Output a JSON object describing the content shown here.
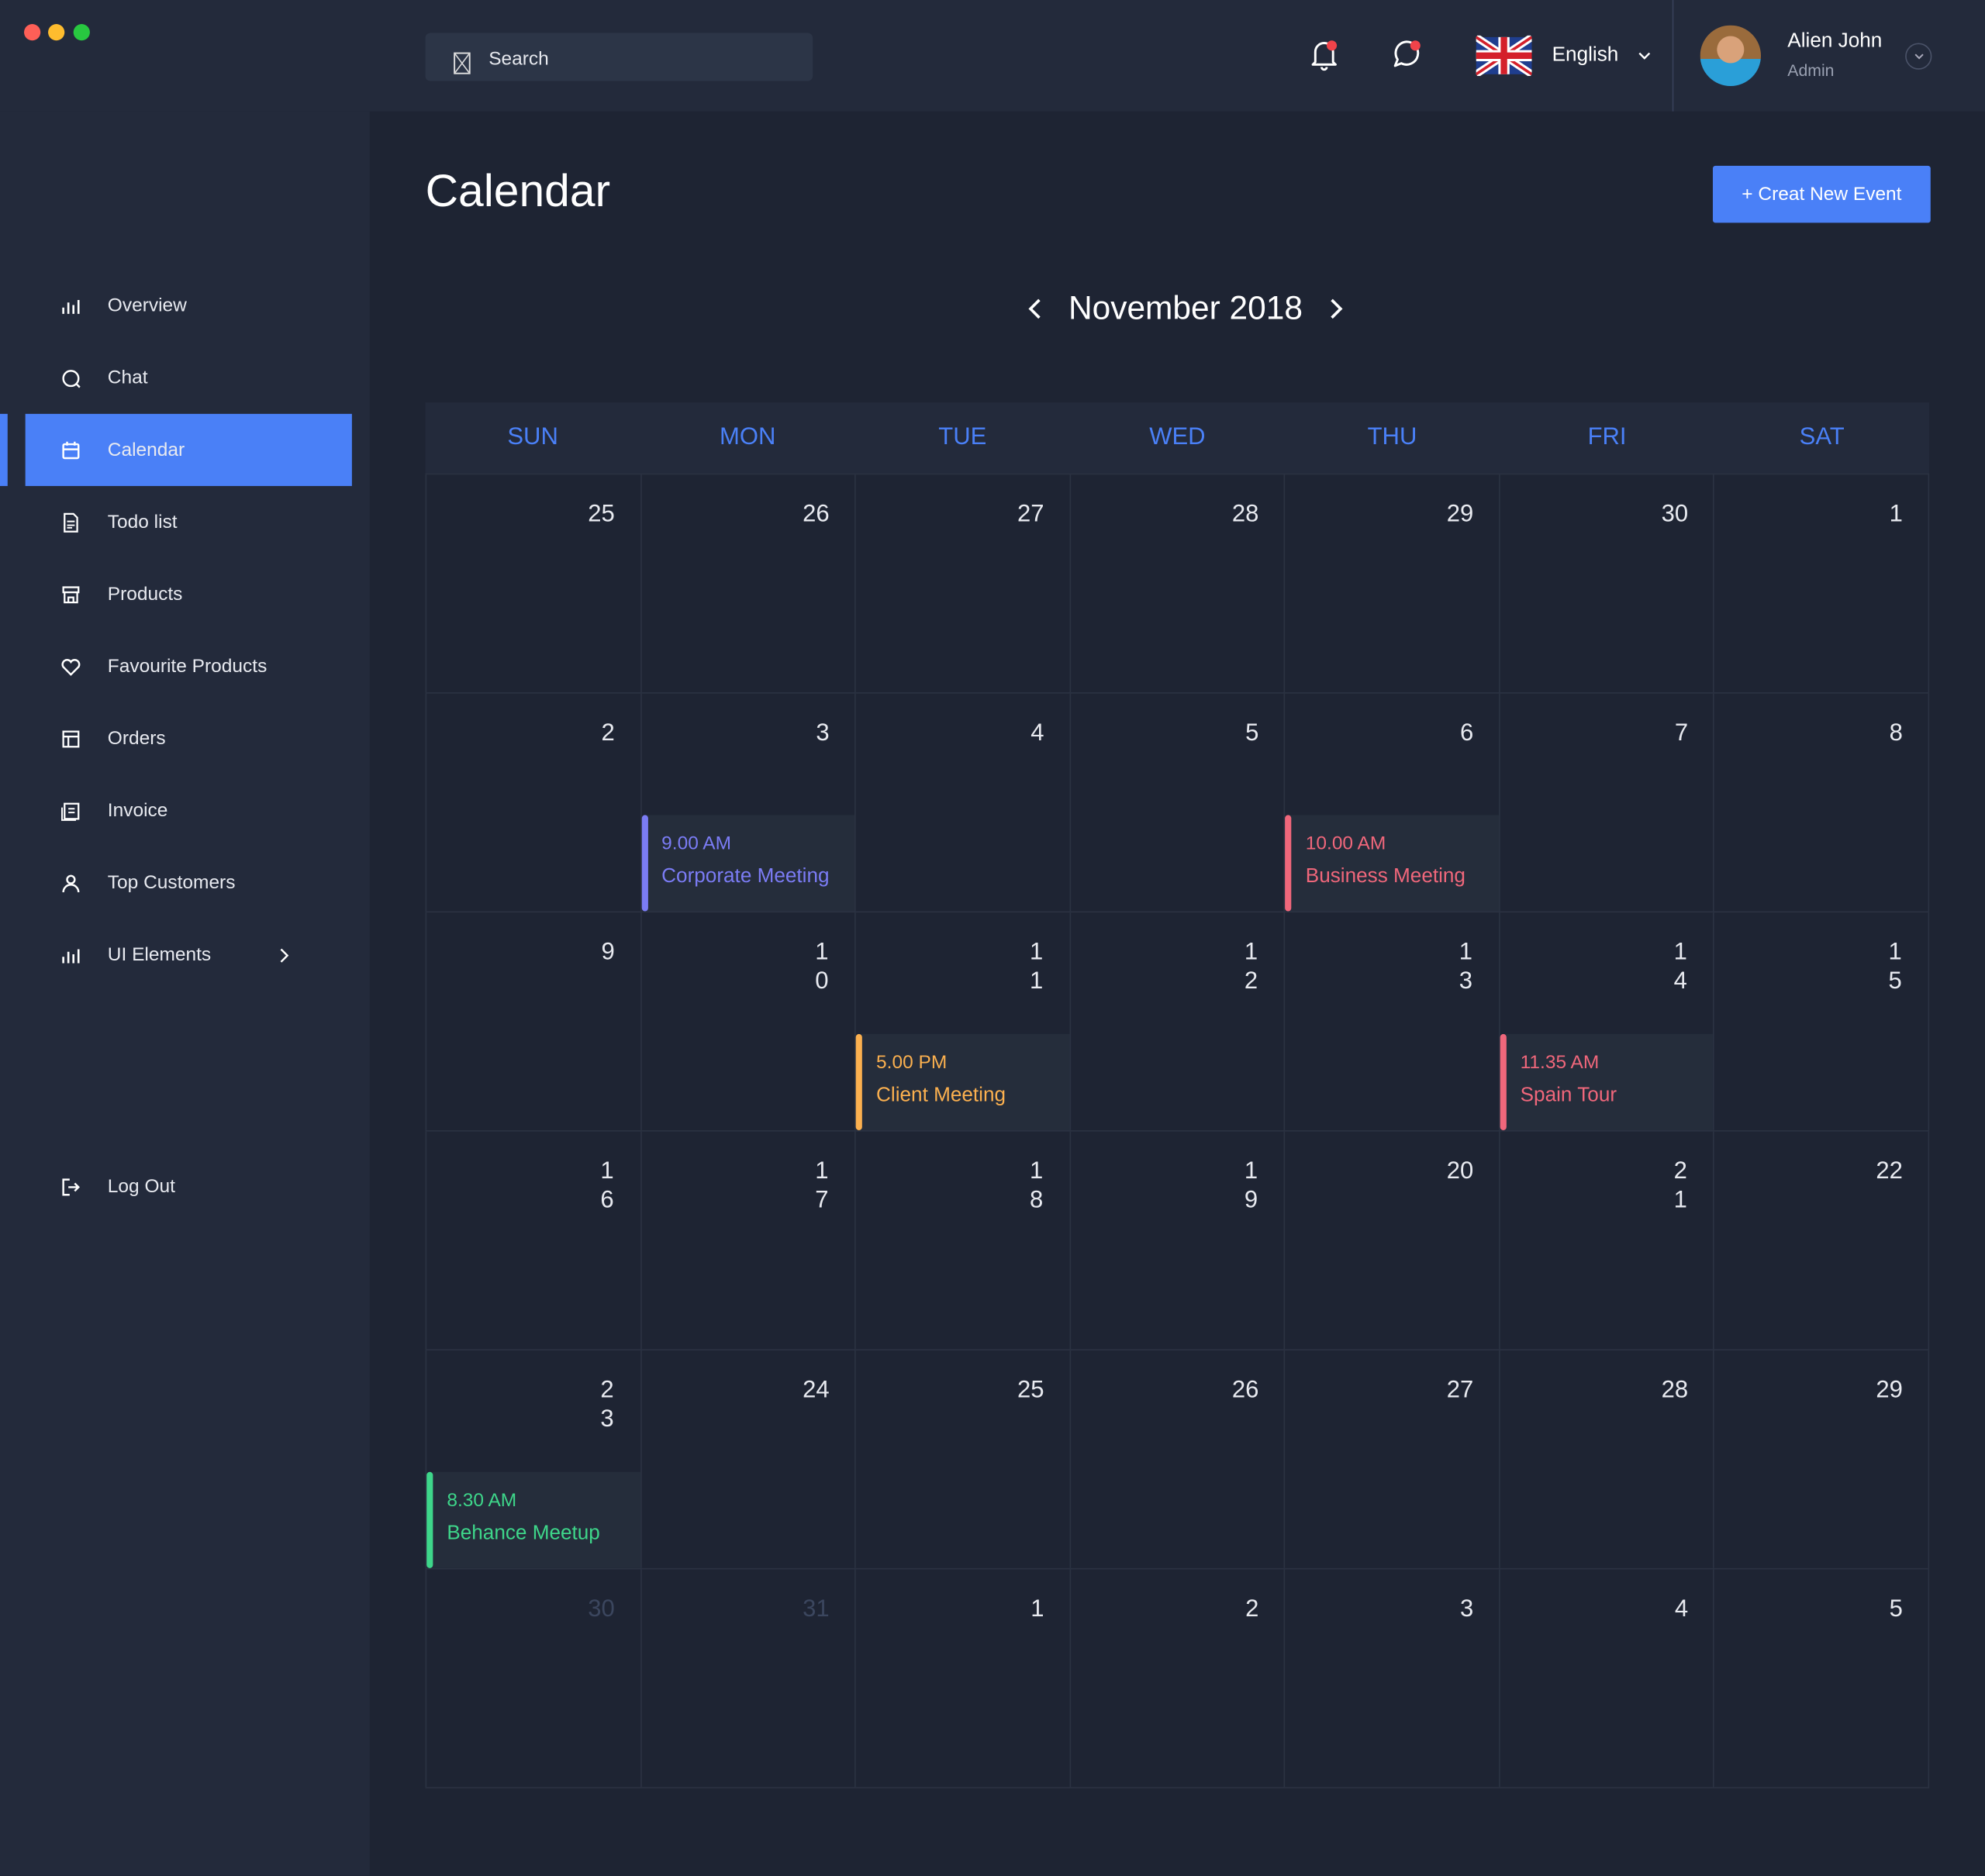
{
  "window_controls": {
    "colors": [
      "#fe5f57",
      "#febc2e",
      "#28c840"
    ]
  },
  "search": {
    "placeholder": "Search",
    "icon": "search-icon"
  },
  "header": {
    "notifications_icon": "bell-icon",
    "messages_icon": "chat-bubble-icon",
    "badge_color": "#f0434a",
    "language": {
      "label": "English",
      "flag": "uk-flag-icon"
    },
    "user": {
      "name": "Alien John",
      "role": "Admin"
    }
  },
  "sidebar": {
    "items": [
      {
        "label": "Overview",
        "icon": "bar-chart-icon"
      },
      {
        "label": "Chat",
        "icon": "chat-icon"
      },
      {
        "label": "Calendar",
        "icon": "calendar-icon",
        "active": true
      },
      {
        "label": "Todo list",
        "icon": "document-icon"
      },
      {
        "label": "Products",
        "icon": "store-icon"
      },
      {
        "label": "Favourite Products",
        "icon": "heart-icon"
      },
      {
        "label": "Orders",
        "icon": "layout-icon"
      },
      {
        "label": "Invoice",
        "icon": "invoice-icon"
      },
      {
        "label": "Top Customers",
        "icon": "user-icon"
      },
      {
        "label": "UI Elements",
        "icon": "bar-chart-icon",
        "has_submenu": true
      }
    ],
    "logout": {
      "label": "Log Out",
      "icon": "logout-icon"
    }
  },
  "page": {
    "title": "Calendar",
    "new_event_label": "+ Creat New Event",
    "accent": "#4a80f7"
  },
  "calendar": {
    "month_label": "November 2018",
    "weekdays": [
      "SUN",
      "MON",
      "TUE",
      "WED",
      "THU",
      "FRI",
      "SAT"
    ],
    "weeks": [
      [
        {
          "d": "25",
          "muted": false
        },
        {
          "d": "26"
        },
        {
          "d": "27"
        },
        {
          "d": "28"
        },
        {
          "d": "29"
        },
        {
          "d": "30"
        },
        {
          "d": "1"
        }
      ],
      [
        {
          "d": "2"
        },
        {
          "d": "3",
          "event": {
            "time": "9.00 AM",
            "title": "Corporate Meeting",
            "color": "#7b7cf5"
          }
        },
        {
          "d": "4"
        },
        {
          "d": "5"
        },
        {
          "d": "6",
          "event": {
            "time": "10.00 AM",
            "title": "Business Meeting",
            "color": "#f0677b"
          }
        },
        {
          "d": "7"
        },
        {
          "d": "8"
        }
      ],
      [
        {
          "d": "9"
        },
        {
          "d": "10"
        },
        {
          "d": "11",
          "event": {
            "time": "5.00 PM",
            "title": "Client Meeting",
            "color": "#fbb04f"
          }
        },
        {
          "d": "12"
        },
        {
          "d": "13"
        },
        {
          "d": "14",
          "event": {
            "time": "11.35 AM",
            "title": "Spain Tour",
            "color": "#f0677b"
          }
        },
        {
          "d": "15"
        }
      ],
      [
        {
          "d": "16"
        },
        {
          "d": "17"
        },
        {
          "d": "18"
        },
        {
          "d": "19"
        },
        {
          "d": "20"
        },
        {
          "d": "21"
        },
        {
          "d": "22"
        }
      ],
      [
        {
          "d": "23",
          "event": {
            "time": "8.30 AM",
            "title": "Behance Meetup",
            "color": "#3ed68a"
          }
        },
        {
          "d": "24"
        },
        {
          "d": "25"
        },
        {
          "d": "26"
        },
        {
          "d": "27"
        },
        {
          "d": "28"
        },
        {
          "d": "29"
        }
      ],
      [
        {
          "d": "30",
          "muted": true
        },
        {
          "d": "31",
          "muted": true
        },
        {
          "d": "1"
        },
        {
          "d": "2"
        },
        {
          "d": "3"
        },
        {
          "d": "4"
        },
        {
          "d": "5"
        }
      ]
    ]
  }
}
